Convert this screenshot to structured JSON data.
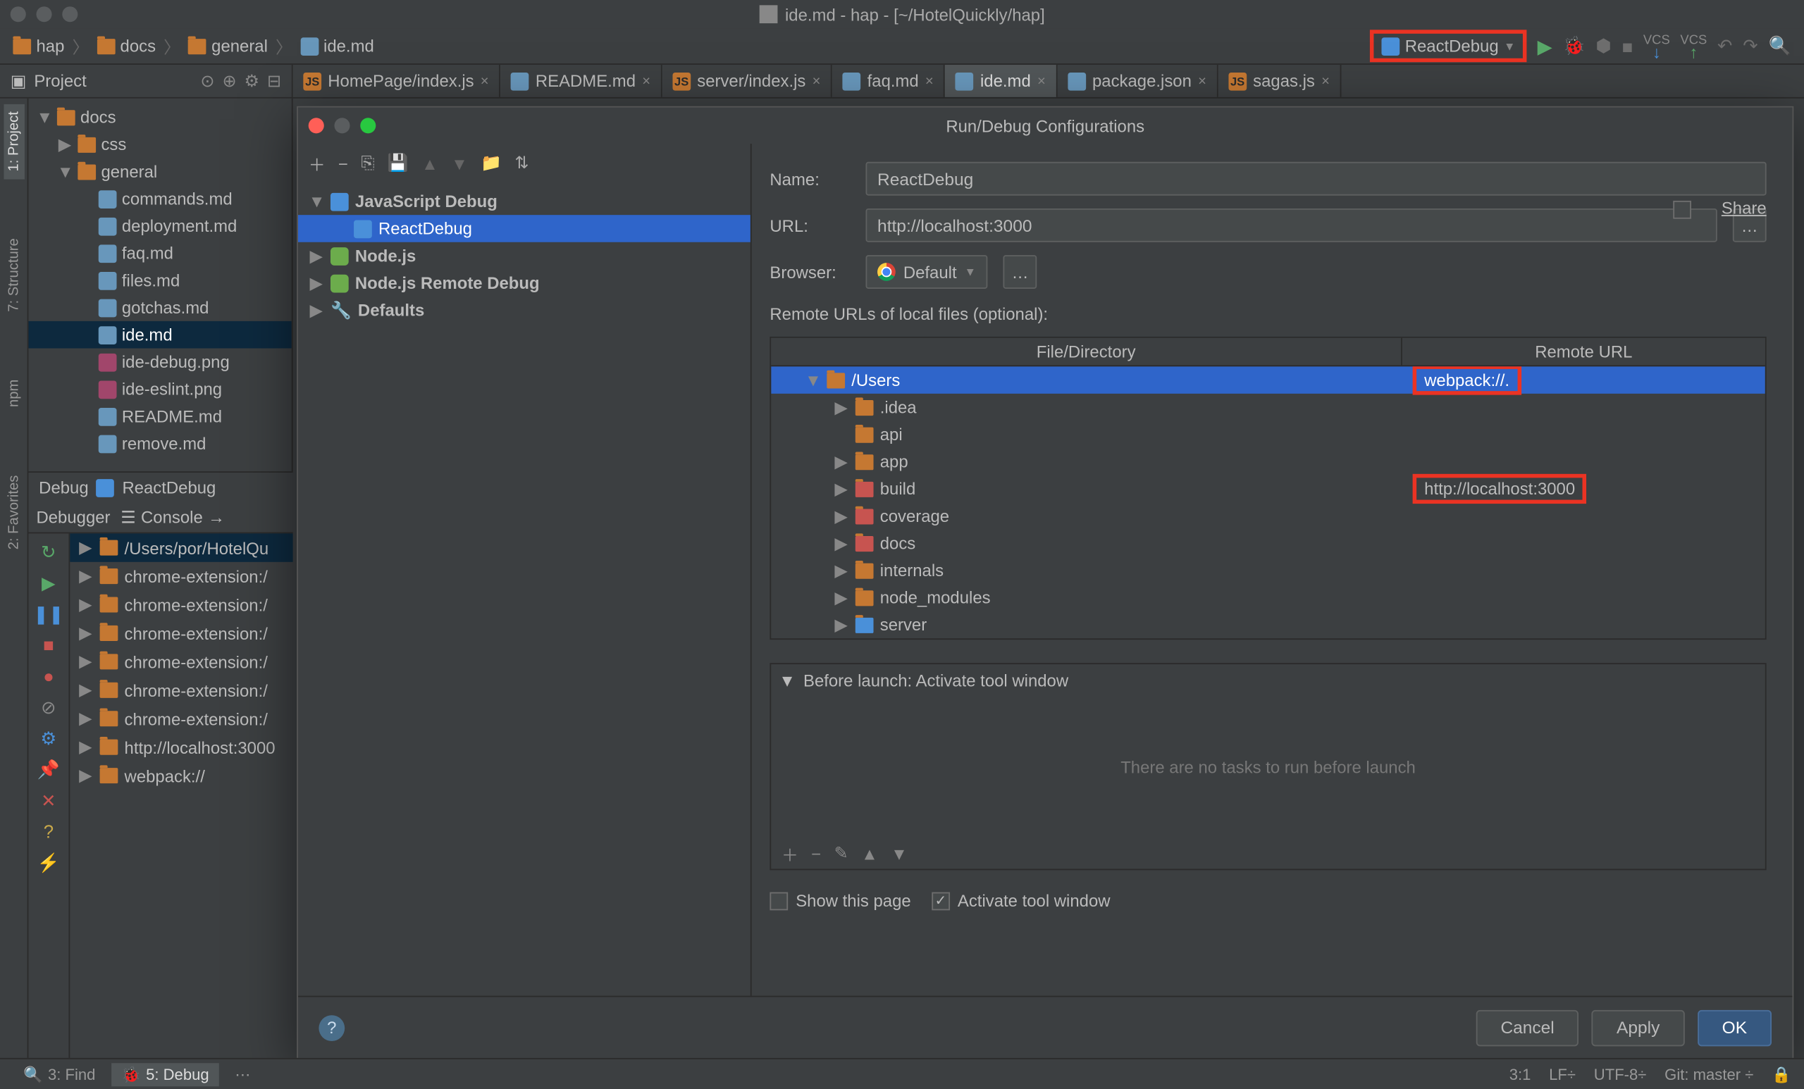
{
  "window_title": "ide.md - hap - [~/HotelQuickly/hap]",
  "breadcrumb": [
    "hap",
    "docs",
    "general",
    "ide.md"
  ],
  "run_config": "ReactDebug",
  "vcs_label": "VCS",
  "project_label": "Project",
  "editor_tabs": [
    {
      "name": "HomePage/index.js",
      "icon": "js"
    },
    {
      "name": "README.md",
      "icon": "md"
    },
    {
      "name": "server/index.js",
      "icon": "js"
    },
    {
      "name": "faq.md",
      "icon": "md"
    },
    {
      "name": "ide.md",
      "icon": "md",
      "active": true
    },
    {
      "name": "package.json",
      "icon": "json"
    },
    {
      "name": "sagas.js",
      "icon": "js"
    }
  ],
  "left_tabs": {
    "project": "1: Project",
    "structure": "7: Structure",
    "favorites": "2: Favorites",
    "npm": "npm"
  },
  "project_tree": [
    {
      "indent": 0,
      "tw": "▼",
      "icon": "folder",
      "label": "docs"
    },
    {
      "indent": 1,
      "tw": "▶",
      "icon": "folder",
      "label": "css"
    },
    {
      "indent": 1,
      "tw": "▼",
      "icon": "folder",
      "label": "general"
    },
    {
      "indent": 2,
      "tw": "",
      "icon": "md",
      "label": "commands.md"
    },
    {
      "indent": 2,
      "tw": "",
      "icon": "md",
      "label": "deployment.md"
    },
    {
      "indent": 2,
      "tw": "",
      "icon": "md",
      "label": "faq.md"
    },
    {
      "indent": 2,
      "tw": "",
      "icon": "md",
      "label": "files.md"
    },
    {
      "indent": 2,
      "tw": "",
      "icon": "md",
      "label": "gotchas.md"
    },
    {
      "indent": 2,
      "tw": "",
      "icon": "md",
      "label": "ide.md",
      "selected": true
    },
    {
      "indent": 2,
      "tw": "",
      "icon": "img",
      "label": "ide-debug.png"
    },
    {
      "indent": 2,
      "tw": "",
      "icon": "img",
      "label": "ide-eslint.png"
    },
    {
      "indent": 2,
      "tw": "",
      "icon": "md",
      "label": "README.md"
    },
    {
      "indent": 2,
      "tw": "",
      "icon": "md",
      "label": "remove.md"
    }
  ],
  "debug_header": {
    "label": "Debug",
    "config": "ReactDebug"
  },
  "debug_tabs": {
    "debugger": "Debugger",
    "console": "Console"
  },
  "debug_tree": [
    {
      "icon": "folder",
      "label": "/Users/por/HotelQu",
      "sel": true,
      "tw": "▶"
    },
    {
      "icon": "folder",
      "label": "chrome-extension:/",
      "tw": "▶"
    },
    {
      "icon": "folder",
      "label": "chrome-extension:/",
      "tw": "▶"
    },
    {
      "icon": "folder",
      "label": "chrome-extension:/",
      "tw": "▶"
    },
    {
      "icon": "folder",
      "label": "chrome-extension:/",
      "tw": "▶"
    },
    {
      "icon": "folder",
      "label": "chrome-extension:/",
      "tw": "▶"
    },
    {
      "icon": "folder",
      "label": "chrome-extension:/",
      "tw": "▶"
    },
    {
      "icon": "folder",
      "label": "http://localhost:3000",
      "tw": "▶"
    },
    {
      "icon": "folder",
      "label": "webpack://",
      "tw": "▶"
    }
  ],
  "dialog": {
    "title": "Run/Debug Configurations",
    "share": "Share",
    "cfg_tree": [
      {
        "indent": 0,
        "tw": "▼",
        "icon": "jsdbg",
        "label": "JavaScript Debug"
      },
      {
        "indent": 1,
        "tw": "",
        "icon": "jsdbg",
        "label": "ReactDebug",
        "sel": true
      },
      {
        "indent": 0,
        "tw": "▶",
        "icon": "node",
        "label": "Node.js"
      },
      {
        "indent": 0,
        "tw": "▶",
        "icon": "node",
        "label": "Node.js Remote Debug"
      },
      {
        "indent": 0,
        "tw": "▶",
        "icon": "wrench",
        "label": "Defaults"
      }
    ],
    "form": {
      "name_label": "Name:",
      "name_value": "ReactDebug",
      "url_label": "URL:",
      "url_value": "http://localhost:3000",
      "browser_label": "Browser:",
      "browser_value": "Default",
      "remote_label": "Remote URLs of local files (optional):",
      "col1": "File/Directory",
      "col2": "Remote URL",
      "rows": [
        {
          "indent": 0,
          "tw": "▼",
          "icon": "folder",
          "label": "/Users",
          "remote": "webpack://.",
          "sel": true,
          "hl": true
        },
        {
          "indent": 1,
          "tw": "▶",
          "icon": "folder",
          "label": ".idea"
        },
        {
          "indent": 1,
          "tw": "",
          "icon": "folder",
          "label": "api"
        },
        {
          "indent": 1,
          "tw": "▶",
          "icon": "folder",
          "label": "app"
        },
        {
          "indent": 1,
          "tw": "▶",
          "icon": "folder-red",
          "label": "build",
          "remote": "http://localhost:3000",
          "hl": true
        },
        {
          "indent": 1,
          "tw": "▶",
          "icon": "folder-red",
          "label": "coverage"
        },
        {
          "indent": 1,
          "tw": "▶",
          "icon": "folder-red",
          "label": "docs"
        },
        {
          "indent": 1,
          "tw": "▶",
          "icon": "folder",
          "label": "internals"
        },
        {
          "indent": 1,
          "tw": "▶",
          "icon": "folder",
          "label": "node_modules"
        },
        {
          "indent": 1,
          "tw": "▶",
          "icon": "folder-blue",
          "label": "server"
        }
      ],
      "before_launch": "Before launch: Activate tool window",
      "no_tasks": "There are no tasks to run before launch",
      "show_page": "Show this page",
      "activate": "Activate tool window"
    },
    "buttons": {
      "cancel": "Cancel",
      "apply": "Apply",
      "ok": "OK"
    }
  },
  "bottom": {
    "find": "3: Find",
    "debug": "5: Debug"
  },
  "status": {
    "pos": "3:1",
    "lf": "LF÷",
    "enc": "UTF-8÷",
    "git": "Git: master ÷"
  }
}
